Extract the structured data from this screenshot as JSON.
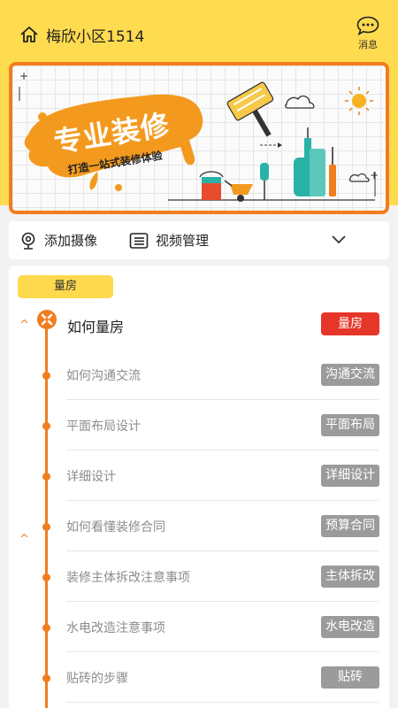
{
  "header": {
    "community": "梅欣小区1514",
    "message_label": "消息"
  },
  "banner": {
    "title": "专业装修",
    "subtitle": "打造一站式装修体验"
  },
  "toolbar": {
    "add_camera": "添加摄像",
    "video_manage": "视频管理"
  },
  "section": {
    "tag": "量房",
    "main_title": "如何量房",
    "main_button": "量房",
    "items": [
      {
        "label": "如何沟通交流",
        "button": "沟通交流"
      },
      {
        "label": "平面布局设计",
        "button": "平面布局"
      },
      {
        "label": "详细设计",
        "button": "详细设计"
      },
      {
        "label": "如何看懂装修合同",
        "button": "预算合同"
      },
      {
        "label": "装修主体拆改注意事项",
        "button": "主体拆改"
      },
      {
        "label": "水电改造注意事项",
        "button": "水电改造"
      },
      {
        "label": "贴砖的步骤",
        "button": "贴砖"
      }
    ]
  },
  "colors": {
    "brand_yellow": "#fedb4f",
    "accent_orange": "#f07d1e",
    "main_button_red": "#e63529",
    "step_button_gray": "#9b9b9b"
  }
}
